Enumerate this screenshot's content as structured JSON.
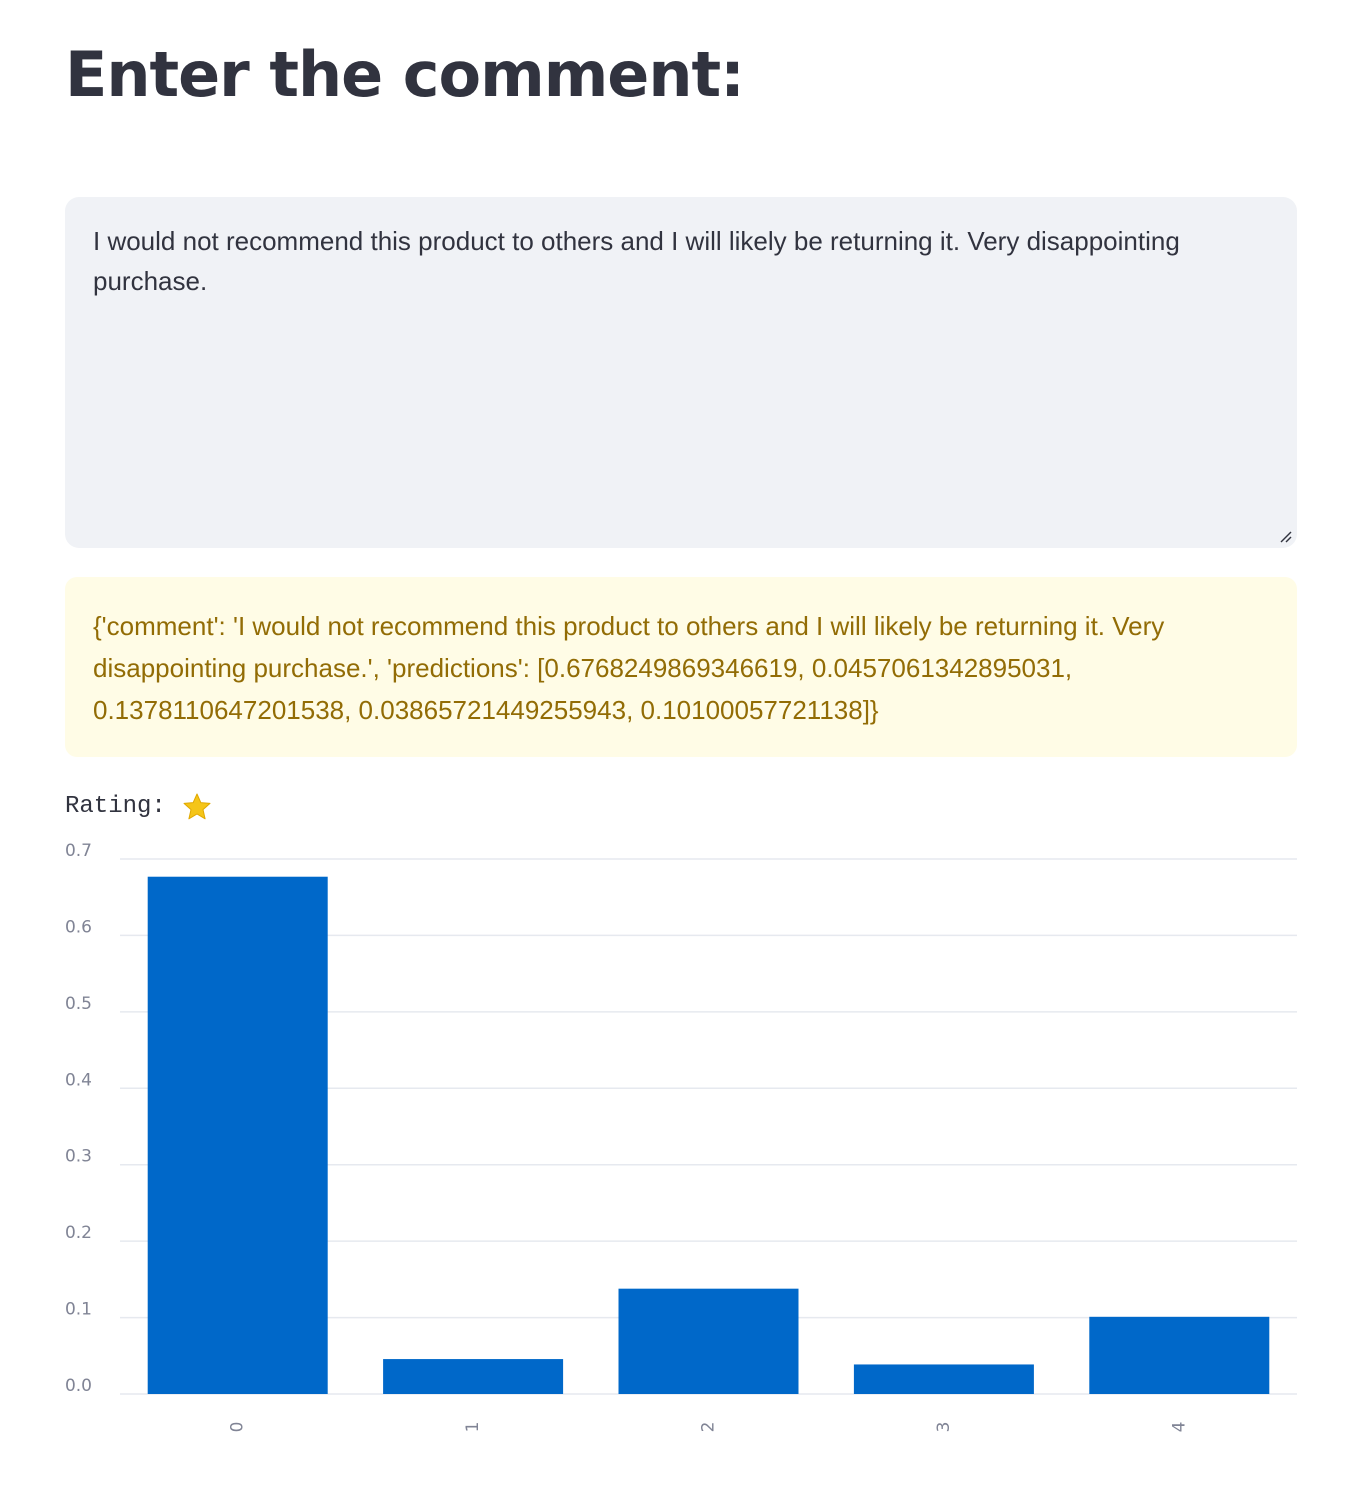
{
  "page": {
    "title": "Enter the comment:"
  },
  "comment_input": {
    "value": "I would not recommend this product to others and I will likely be returning it. Very disappointing purchase."
  },
  "result": {
    "text": "{'comment': 'I would not recommend this product to others and I will likely be returning it. Very disappointing purchase.', 'predictions': [0.6768249869346619, 0.0457061342895031, 0.1378110647201538, 0.03865721449255943, 0.10100057721138]}"
  },
  "rating": {
    "label": "Rating:",
    "stars": 1,
    "icon": "star-icon"
  },
  "colors": {
    "bar": "#0068c9",
    "grid": "#e6e9ef",
    "tick_text": "#808495",
    "info_bg": "#fffce6",
    "info_text": "#926c05",
    "input_bg": "#f0f2f6",
    "star": "#f5c518"
  },
  "chart_data": {
    "type": "bar",
    "categories": [
      "0",
      "1",
      "2",
      "3",
      "4"
    ],
    "values": [
      0.6768249869346619,
      0.0457061342895031,
      0.1378110647201538,
      0.03865721449255943,
      0.10100057721138
    ],
    "title": "",
    "xlabel": "",
    "ylabel": "",
    "ylim": [
      0,
      0.7
    ],
    "yticks": [
      "0.0",
      "0.1",
      "0.2",
      "0.3",
      "0.4",
      "0.5",
      "0.6",
      "0.7"
    ],
    "grid": true,
    "x_tick_rotation": "vertical"
  }
}
